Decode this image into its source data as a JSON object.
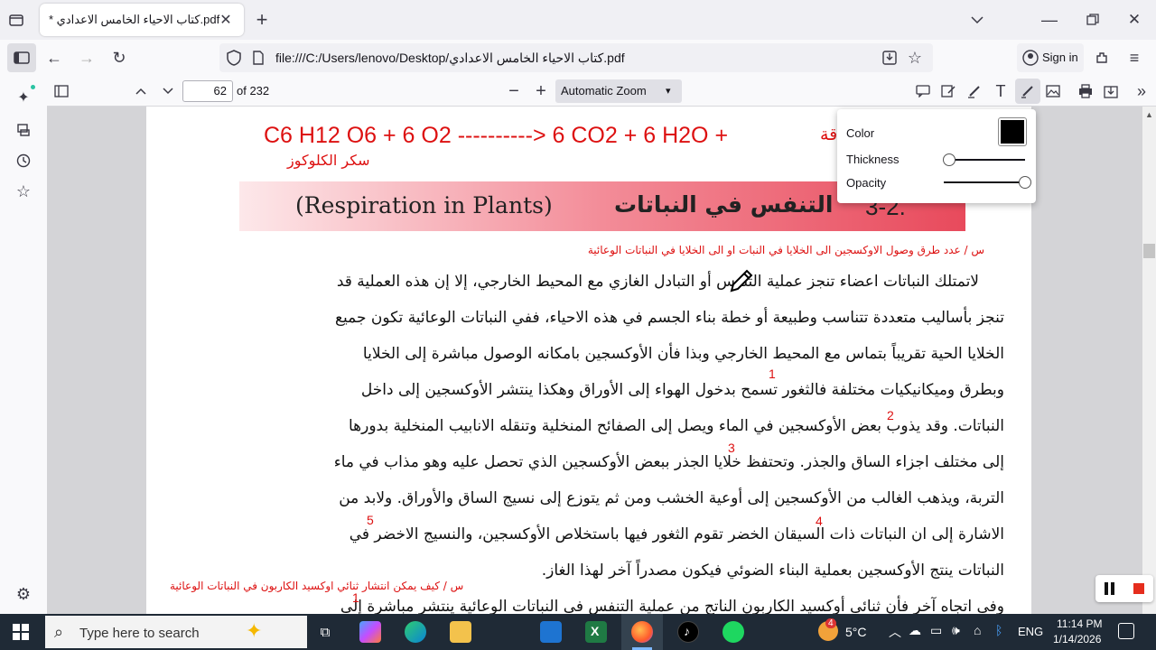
{
  "tab": {
    "title": "* كتاب الاحياء الخامس الاعدادي.pdf"
  },
  "nav": {
    "url": "file:///C:/Users/lenovo/Desktop/كتاب الاحياء الخامس الاعدادي.pdf",
    "sign_in": "Sign in"
  },
  "pdf": {
    "page_number": "62",
    "page_total": "of 232",
    "zoom": "Automatic Zoom"
  },
  "popup": {
    "color_label": "Color",
    "color_value": "#000000",
    "thickness_label": "Thickness",
    "opacity_label": "Opacity",
    "thickness": 0.0,
    "opacity": 1.0
  },
  "doc": {
    "equation": "C6 H12 O6 + 6 O2 ----------> 6 CO2 + 6 H2O + ",
    "equation_suffix": "قة",
    "glucose": "سكر الكلوكوز",
    "heading_en": "(Respiration in Plants)",
    "heading_ar": "التنفس في النباتات",
    "heading_num": "3-2.",
    "question1": "س / عدد طرق وصول الاوكسجين الى الخلايا في النبات او الى الخلايا في النباتات الوعائية",
    "lines": [
      "لاتمتلك النباتات اعضاء تنجز عملية التنفس أو التبادل الغازي مع المحيط الخارجي، إلا إن هذه العملية قد",
      "تنجز بأساليب متعددة تتناسب وطبيعة أو خطة بناء الجسم في هذه الاحياء، ففي النباتات الوعائية تكون جميع",
      "الخلايا الحية تقريباً بتماس مع المحيط الخارجي وبذا فأن الأوكسجين بامكانه الوصول مباشرة إلى الخلايا",
      "وبطرق وميكانيكيات مختلفة فالثغور تسمح بدخول الهواء إلى الأوراق وهكذا ينتشر الأوكسجين إلى داخل",
      "النباتات. وقد يذوب بعض الأوكسجين في الماء  ويصل إلى الصفائح المنخلية وتنقله الانابيب المنخلية بدورها",
      "إلى مختلف اجزاء الساق والجذر. وتحتفظ خلايا الجذر ببعض الأوكسجين الذي تحصل عليه وهو مذاب في ماء",
      "التربة، ويذهب الغالب من الأوكسجين إلى أوعية الخشب ومن ثم يتوزع إلى نسيج الساق والأوراق. ولابد من",
      "الاشارة إلى ان النباتات ذات السيقان الخضر تقوم الثغور فيها باستخلاص الأوكسجين، والنسيج الاخضر في",
      "النباتات ينتج الأوكسجين بعملية البناء الضوئي فيكون مصدراً آخر لهذا الغاز.",
      "وفي اتجاه آخر فأن ثنائي أوكسيد الكاربون الناتج من عملية التنفس في النباتات الوعائية ينتشر مباشرة إلى"
    ],
    "question2": "س / كيف يمكن انتشار ثنائي اوكسيد الكاربون في النباتات الوعائية",
    "numbers": [
      "1",
      "2",
      "3",
      "4",
      "5",
      "1"
    ]
  },
  "taskbar": {
    "search_placeholder": "Type here to search",
    "weather": "5°C",
    "lang": "ENG",
    "time": "11:14 PM",
    "date": "1/14/2026",
    "badge": "4"
  }
}
